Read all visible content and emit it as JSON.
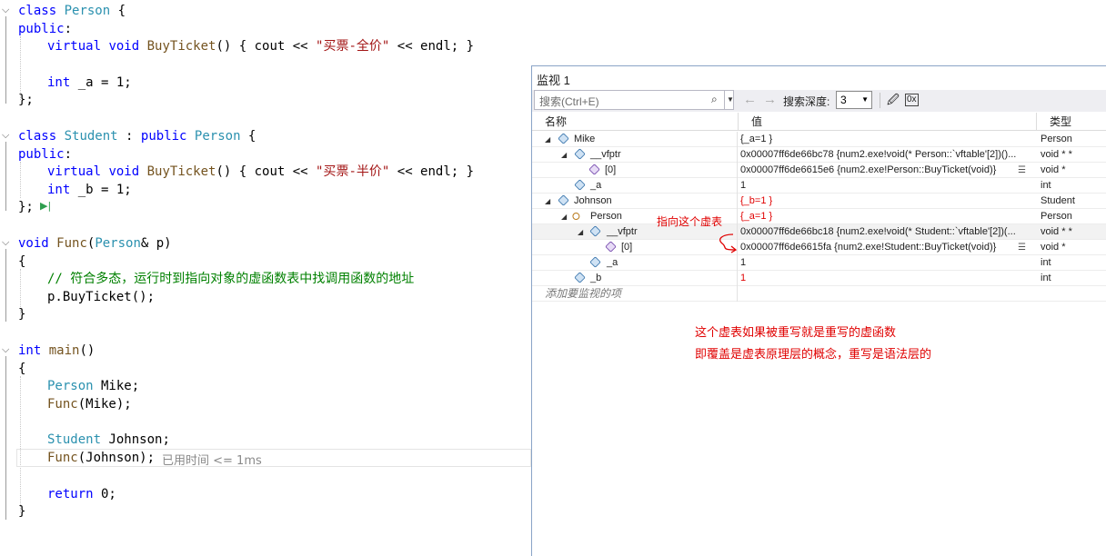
{
  "code": {
    "lines": [
      {
        "kw1": "class",
        "ty1": "Person",
        "rest": " {"
      },
      {
        "kw1": "public",
        "rest": ":"
      },
      {
        "kw1": "virtual",
        "kw2": "void",
        "fn1": "BuyTicket",
        "rest": "() { cout << ",
        "str": "\"买票-全价\"",
        "rest2": " << endl; }"
      },
      {
        "kw1": "int",
        "rest": " _a = 1;"
      },
      {
        "rest": "};"
      },
      {
        "kw1": "class",
        "ty1": "Student",
        "rest": " : ",
        "kw2": "public",
        "ty2": "Person",
        "rest2": " {"
      },
      {
        "kw1": "public",
        "rest": ":"
      },
      {
        "kw1": "virtual",
        "kw2": "void",
        "fn1": "BuyTicket",
        "rest": "() { cout << ",
        "str": "\"买票-半价\"",
        "rest2": " << endl; }"
      },
      {
        "kw1": "int",
        "rest": " _b = 1;"
      },
      {
        "rest": "};"
      },
      {
        "kw1": "void",
        "fn1": "Func",
        "ty1": "Person",
        "rest": "& p)"
      },
      {
        "rest": "{"
      },
      {
        "cm": "// 符合多态，运行时到指向对象的虚函数表中找调用函数的地址"
      },
      {
        "rest": "p.BuyTicket();"
      },
      {
        "rest": "}"
      },
      {
        "kw1": "int",
        "fn1": "main",
        "rest": "()"
      },
      {
        "rest": "{"
      },
      {
        "ty1": "Person",
        "rest": " Mike;"
      },
      {
        "fn1": "Func",
        "rest": "(Mike);"
      },
      {
        "ty1": "Student",
        "rest": " Johnson;"
      },
      {
        "fn1": "Func",
        "rest": "(Johnson);"
      },
      {
        "kw1": "return",
        "rest": " 0;"
      },
      {
        "rest": "}"
      }
    ],
    "elapsed_hint": "已用时间 <= 1ms"
  },
  "watch": {
    "title": "监视 1",
    "search_placeholder": "搜索(Ctrl+E)",
    "depth_label": "搜索深度:",
    "depth_value": "3",
    "headers": {
      "name": "名称",
      "value": "值",
      "type": "类型"
    },
    "rows": [
      {
        "name": "Mike",
        "value": "{_a=1 }",
        "type": "Person"
      },
      {
        "name": "__vfptr",
        "value": "0x00007ff6de66bc78 {num2.exe!void(* Person::`vftable'[2])()...",
        "type": "void * *"
      },
      {
        "name": "[0]",
        "value": "0x00007ff6de6615e6 {num2.exe!Person::BuyTicket(void)}",
        "type": "void *"
      },
      {
        "name": "_a",
        "value": "1",
        "type": "int"
      },
      {
        "name": "Johnson",
        "value": "{_b=1 }",
        "type": "Student"
      },
      {
        "name": "Person",
        "value": "{_a=1 }",
        "type": "Person"
      },
      {
        "name": "__vfptr",
        "value": "0x00007ff6de66bc18 {num2.exe!void(* Student::`vftable'[2])(...",
        "type": "void * *"
      },
      {
        "name": "[0]",
        "value": "0x00007ff6de6615fa {num2.exe!Student::BuyTicket(void)}",
        "type": "void *"
      },
      {
        "name": "_a",
        "value": "1",
        "type": "int"
      },
      {
        "name": "_b",
        "value": "1",
        "type": "int"
      }
    ],
    "add_watch": "添加要监视的项"
  },
  "annotations": {
    "pointer_note": "指向这个虚表",
    "note_line1": "这个虚表如果被重写就是重写的虚函数",
    "note_line2": "即覆盖是虚表原理层的概念，重写是语法层的"
  },
  "colors": {
    "keyword": "#0000ff",
    "type": "#2b91af",
    "string": "#a31515",
    "comment": "#008000",
    "annotation": "#e00000"
  }
}
